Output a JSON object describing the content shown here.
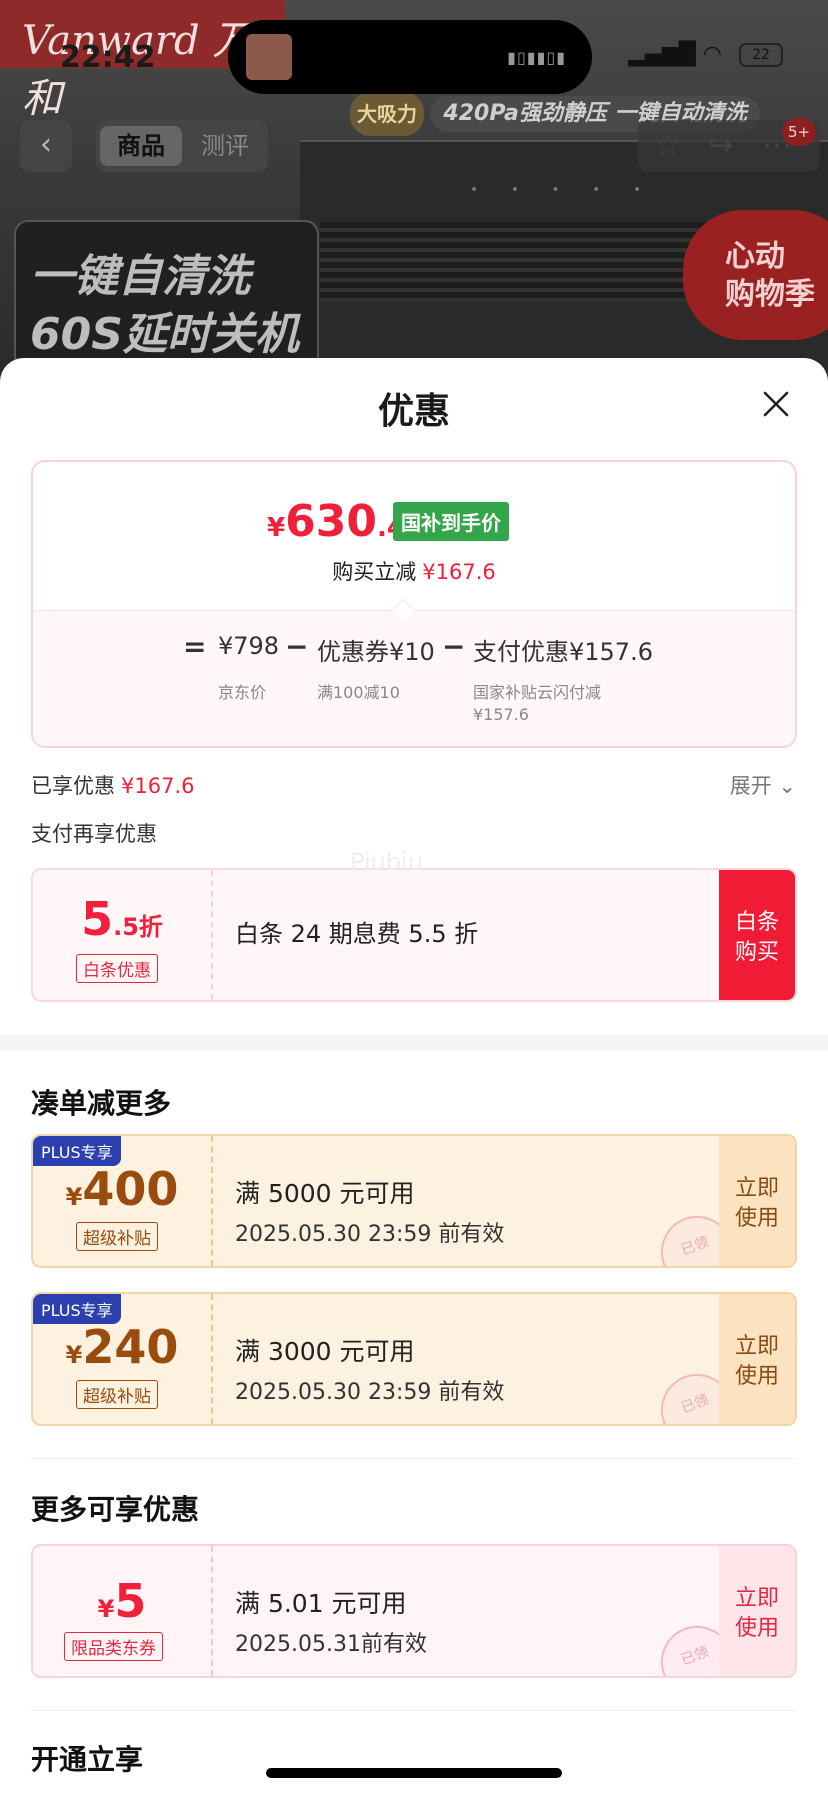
{
  "background": {
    "brand_text": "Vanward 万和",
    "badge_power": "大吸力",
    "badge_feature": "420Pa强劲静压 一键自动清洗",
    "slogan_line1": "一键自清洗",
    "slogan_line2": "60S延时关机",
    "promo_line1": "心动",
    "promo_line2": "购物季"
  },
  "status_bar": {
    "time": "22:42",
    "battery": "22"
  },
  "nav": {
    "tabs": [
      "商品",
      "测评"
    ],
    "message_badge": "5+"
  },
  "sheet": {
    "title": "优惠",
    "price": {
      "currency": "¥",
      "final_int": "630",
      "final_dec": ".4",
      "tag": "国补到手价",
      "reduce_label": "购买立减",
      "reduce_amount": "¥167.6",
      "formula": {
        "equals": "=",
        "minus": "−",
        "items": [
          {
            "value": "¥798",
            "sub": "京东价"
          },
          {
            "value": "优惠券¥10",
            "sub": "满100减10"
          },
          {
            "value": "支付优惠¥157.6",
            "sub1": "国家补贴云闪付减",
            "sub2": "¥157.6"
          }
        ]
      }
    },
    "enjoyed_label": "已享优惠",
    "enjoyed_amount": "¥167.6",
    "expand_label": "展开",
    "pay_more_label": "支付再享优惠",
    "baitiao": {
      "rate_big": "5",
      "rate_small": ".5折",
      "tag": "白条优惠",
      "desc": "白条 24 期息费 5.5 折",
      "action_line1": "白条",
      "action_line2": "购买"
    },
    "watermark": "Piubiu",
    "section_combine": "凑单减更多",
    "plus_coupons": [
      {
        "badge": "PLUS专享",
        "currency": "¥",
        "amount": "400",
        "tag": "超级补贴",
        "condition": "满 5000 元可用",
        "expiry": "2025.05.30 23:59 前有效",
        "action_line1": "立即",
        "action_line2": "使用",
        "stamp": "已领"
      },
      {
        "badge": "PLUS专享",
        "currency": "¥",
        "amount": "240",
        "tag": "超级补贴",
        "condition": "满 3000 元可用",
        "expiry": "2025.05.30 23:59 前有效",
        "action_line1": "立即",
        "action_line2": "使用",
        "stamp": "已领"
      }
    ],
    "section_more": "更多可享优惠",
    "jd_coupon": {
      "currency": "¥",
      "amount": "5",
      "tag": "限品类东券",
      "condition": "满 5.01 元可用",
      "expiry": "2025.05.31前有效",
      "action_line1": "立即",
      "action_line2": "使用",
      "stamp": "已领"
    },
    "section_open": "开通立享"
  }
}
